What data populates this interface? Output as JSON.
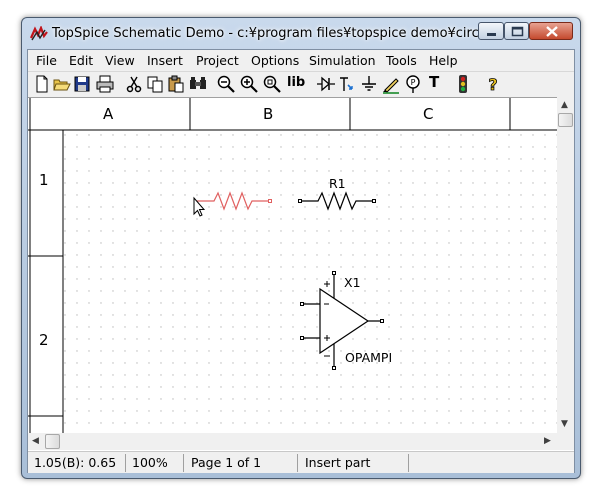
{
  "window": {
    "title": "TopSpice Schematic Demo - c:¥program files¥topspice demo¥circuits...",
    "accent": "#b8cde4"
  },
  "menu": {
    "items": [
      "File",
      "Edit",
      "View",
      "Insert",
      "Project",
      "Options",
      "Simulation",
      "Tools",
      "Help"
    ]
  },
  "toolbar": {
    "buttons": [
      {
        "name": "new-document-icon"
      },
      {
        "name": "open-folder-icon"
      },
      {
        "name": "save-icon"
      },
      {
        "name": "print-icon"
      },
      {
        "name": "cut-icon"
      },
      {
        "name": "copy-icon"
      },
      {
        "name": "paste-icon"
      },
      {
        "name": "find-icon"
      },
      {
        "name": "zoom-out-icon"
      },
      {
        "name": "zoom-in-icon"
      },
      {
        "name": "zoom-fit-icon"
      },
      {
        "name": "library-button",
        "label": "lib"
      },
      {
        "name": "diode-icon"
      },
      {
        "name": "transistor-icon"
      },
      {
        "name": "ground-icon"
      },
      {
        "name": "wire-pen-icon"
      },
      {
        "name": "probe-icon"
      },
      {
        "name": "text-button",
        "label": "T"
      },
      {
        "name": "traffic-light-icon"
      },
      {
        "name": "help-question-icon"
      }
    ]
  },
  "sheet": {
    "columns": [
      "A",
      "B",
      "C"
    ],
    "rows": [
      "1",
      "2"
    ]
  },
  "components": {
    "resistor_label": "R1",
    "opamp_ref": "X1",
    "opamp_model": "OPAMPI",
    "ghost_color": "#e06060"
  },
  "status": {
    "coords": "1.05(B): 0.65",
    "zoom": "100%",
    "page": "Page 1 of 1",
    "mode": "Insert part"
  }
}
